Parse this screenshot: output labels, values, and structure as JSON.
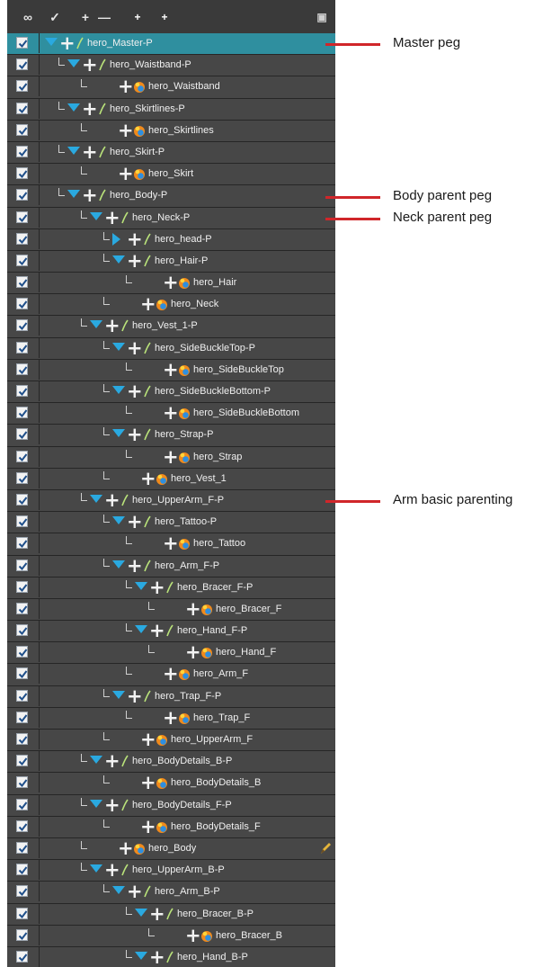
{
  "toolbar": {
    "buttons": [
      {
        "name": "show-all-onion-skin",
        "icon": "onion-skin-icon",
        "label": "∞"
      },
      {
        "name": "enable-disable-all",
        "icon": "enable-all-icon",
        "label": "✓"
      },
      {
        "name": "add-layer",
        "icon": "add-layer-icon",
        "label": "+"
      },
      {
        "name": "delete-layer",
        "icon": "delete-layer-icon",
        "label": "—"
      },
      {
        "name": "add-peg",
        "icon": "add-peg-icon",
        "label": "+"
      },
      {
        "name": "add-drawing-peg",
        "icon": "add-drawing-peg-icon",
        "label": "+"
      },
      {
        "name": "panel-menu",
        "icon": "panel-menu-icon",
        "label": "▣"
      }
    ]
  },
  "layers": [
    {
      "name": "hero_Master-P",
      "type": "peg",
      "depth": 0,
      "expand": "down",
      "selected": true,
      "checked": true
    },
    {
      "name": "hero_Waistband-P",
      "type": "peg",
      "depth": 1,
      "expand": "down",
      "checked": true
    },
    {
      "name": "hero_Waistband",
      "type": "drawing",
      "depth": 2,
      "checked": true
    },
    {
      "name": "hero_Skirtlines-P",
      "type": "peg",
      "depth": 1,
      "expand": "down",
      "checked": true
    },
    {
      "name": "hero_Skirtlines",
      "type": "drawing",
      "depth": 2,
      "checked": true
    },
    {
      "name": "hero_Skirt-P",
      "type": "peg",
      "depth": 1,
      "expand": "down",
      "checked": true
    },
    {
      "name": "hero_Skirt",
      "type": "drawing",
      "depth": 2,
      "checked": true
    },
    {
      "name": "hero_Body-P",
      "type": "peg",
      "depth": 1,
      "expand": "down",
      "checked": true
    },
    {
      "name": "hero_Neck-P",
      "type": "peg",
      "depth": 2,
      "expand": "down",
      "checked": true
    },
    {
      "name": "hero_head-P",
      "type": "peg",
      "depth": 3,
      "expand": "right",
      "checked": true
    },
    {
      "name": "hero_Hair-P",
      "type": "peg",
      "depth": 3,
      "expand": "down",
      "checked": true
    },
    {
      "name": "hero_Hair",
      "type": "drawing",
      "depth": 4,
      "checked": true
    },
    {
      "name": "hero_Neck",
      "type": "drawing",
      "depth": 3,
      "checked": true
    },
    {
      "name": "hero_Vest_1-P",
      "type": "peg",
      "depth": 2,
      "expand": "down",
      "checked": true
    },
    {
      "name": "hero_SideBuckleTop-P",
      "type": "peg",
      "depth": 3,
      "expand": "down",
      "checked": true
    },
    {
      "name": "hero_SideBuckleTop",
      "type": "drawing",
      "depth": 4,
      "checked": true
    },
    {
      "name": "hero_SideBuckleBottom-P",
      "type": "peg",
      "depth": 3,
      "expand": "down",
      "checked": true
    },
    {
      "name": "hero_SideBuckleBottom",
      "type": "drawing",
      "depth": 4,
      "checked": true
    },
    {
      "name": "hero_Strap-P",
      "type": "peg",
      "depth": 3,
      "expand": "down",
      "checked": true
    },
    {
      "name": "hero_Strap",
      "type": "drawing",
      "depth": 4,
      "checked": true
    },
    {
      "name": "hero_Vest_1",
      "type": "drawing",
      "depth": 3,
      "checked": true
    },
    {
      "name": "hero_UpperArm_F-P",
      "type": "peg",
      "depth": 2,
      "expand": "down",
      "checked": true
    },
    {
      "name": "hero_Tattoo-P",
      "type": "peg",
      "depth": 3,
      "expand": "down",
      "checked": true
    },
    {
      "name": "hero_Tattoo",
      "type": "drawing",
      "depth": 4,
      "checked": true
    },
    {
      "name": "hero_Arm_F-P",
      "type": "peg",
      "depth": 3,
      "expand": "down",
      "checked": true
    },
    {
      "name": "hero_Bracer_F-P",
      "type": "peg",
      "depth": 4,
      "expand": "down",
      "checked": true
    },
    {
      "name": "hero_Bracer_F",
      "type": "drawing",
      "depth": 5,
      "checked": true
    },
    {
      "name": "hero_Hand_F-P",
      "type": "peg",
      "depth": 4,
      "expand": "down",
      "checked": true
    },
    {
      "name": "hero_Hand_F",
      "type": "drawing",
      "depth": 5,
      "checked": true
    },
    {
      "name": "hero_Arm_F",
      "type": "drawing",
      "depth": 4,
      "checked": true
    },
    {
      "name": "hero_Trap_F-P",
      "type": "peg",
      "depth": 3,
      "expand": "down",
      "checked": true
    },
    {
      "name": "hero_Trap_F",
      "type": "drawing",
      "depth": 4,
      "checked": true
    },
    {
      "name": "hero_UpperArm_F",
      "type": "drawing",
      "depth": 3,
      "checked": true
    },
    {
      "name": "hero_BodyDetails_B-P",
      "type": "peg",
      "depth": 2,
      "expand": "down",
      "checked": true
    },
    {
      "name": "hero_BodyDetails_B",
      "type": "drawing",
      "depth": 3,
      "checked": true
    },
    {
      "name": "hero_BodyDetails_F-P",
      "type": "peg",
      "depth": 2,
      "expand": "down",
      "checked": true
    },
    {
      "name": "hero_BodyDetails_F",
      "type": "drawing",
      "depth": 3,
      "checked": true
    },
    {
      "name": "hero_Body",
      "type": "drawing",
      "depth": 2,
      "checked": true,
      "pencil": true
    },
    {
      "name": "hero_UpperArm_B-P",
      "type": "peg",
      "depth": 2,
      "expand": "down",
      "checked": true
    },
    {
      "name": "hero_Arm_B-P",
      "type": "peg",
      "depth": 3,
      "expand": "down",
      "checked": true
    },
    {
      "name": "hero_Bracer_B-P",
      "type": "peg",
      "depth": 4,
      "expand": "down",
      "checked": true
    },
    {
      "name": "hero_Bracer_B",
      "type": "drawing",
      "depth": 5,
      "checked": true
    },
    {
      "name": "hero_Hand_B-P",
      "type": "peg",
      "depth": 4,
      "expand": "down",
      "checked": true
    }
  ],
  "annotations": [
    {
      "text": "Master peg",
      "row": 0
    },
    {
      "text": "Body parent peg",
      "row": 7
    },
    {
      "text": "Neck parent peg",
      "row": 8
    },
    {
      "text": "Arm basic parenting",
      "row": 21
    }
  ],
  "colors": {
    "panel_bg": "#474747",
    "selected_row": "#2f8f9f",
    "expand_triangle": "#2aa9e0",
    "annotation_line": "#d0262a"
  }
}
